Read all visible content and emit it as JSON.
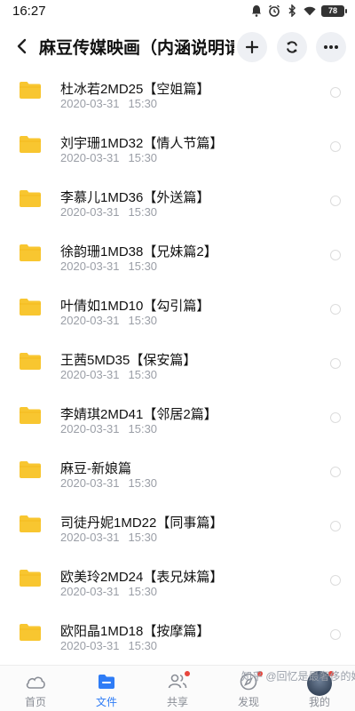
{
  "status": {
    "time": "16:27",
    "battery": "78"
  },
  "header": {
    "title": "麻豆传媒映画（内涵说明请…"
  },
  "files": [
    {
      "name": "杜冰若2MD25【空姐篇】",
      "date": "2020-03-31",
      "time": "15:30"
    },
    {
      "name": "刘宇珊1MD32【情人节篇】",
      "date": "2020-03-31",
      "time": "15:30"
    },
    {
      "name": "李慕儿1MD36【外送篇】",
      "date": "2020-03-31",
      "time": "15:30"
    },
    {
      "name": "徐韵珊1MD38【兄妹篇2】",
      "date": "2020-03-31",
      "time": "15:30"
    },
    {
      "name": "叶倩如1MD10【勾引篇】",
      "date": "2020-03-31",
      "time": "15:30"
    },
    {
      "name": "王茜5MD35【保安篇】",
      "date": "2020-03-31",
      "time": "15:30"
    },
    {
      "name": "李婧琪2MD41【邻居2篇】",
      "date": "2020-03-31",
      "time": "15:30"
    },
    {
      "name": "麻豆-新娘篇",
      "date": "2020-03-31",
      "time": "15:30"
    },
    {
      "name": "司徒丹妮1MD22【同事篇】",
      "date": "2020-03-31",
      "time": "15:30"
    },
    {
      "name": "欧美玲2MD24【表兄妹篇】",
      "date": "2020-03-31",
      "time": "15:30"
    },
    {
      "name": "欧阳晶1MD18【按摩篇】",
      "date": "2020-03-31",
      "time": "15:30"
    }
  ],
  "bottom_tabs": [
    {
      "label": "首页",
      "icon": "cloud-icon"
    },
    {
      "label": "文件",
      "icon": "folder-icon",
      "active": true
    },
    {
      "label": "共享",
      "icon": "people-icon"
    },
    {
      "label": "发现",
      "icon": "compass-icon"
    },
    {
      "label": "我的",
      "icon": "avatar"
    }
  ],
  "watermark": "知乎 @回忆是最奢侈的她",
  "colors": {
    "accent": "#2e7cf6",
    "folder": "#f8c630",
    "badge": "#e8453c"
  }
}
